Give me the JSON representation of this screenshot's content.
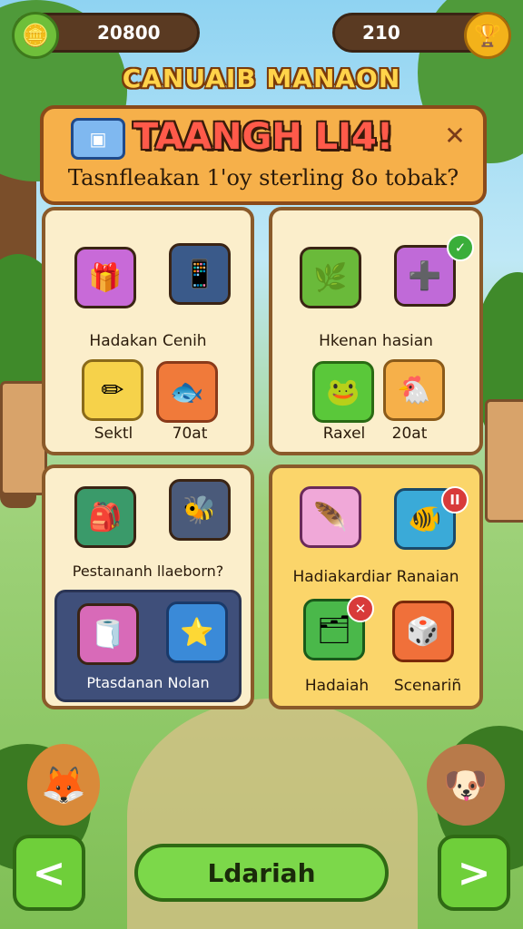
{
  "resources": {
    "coins": "20800",
    "gems": "210",
    "coin_icon": "coin-bundle-icon",
    "gem_icon": "trophy-icon"
  },
  "subtitle": "CANUAIB MANAON",
  "banner": {
    "title": "TAANGH LI4!",
    "text": "Tasnfleakan 1'oy sterling 8o tobak?"
  },
  "panels": {
    "p1": {
      "label_top": "Hadakan Cenih",
      "item_a": "Sektl",
      "item_b": "70at"
    },
    "p2": {
      "label_top": "Hkenan hasian",
      "item_a": "Raxel",
      "item_b": "20at"
    },
    "p3": {
      "label_top": "Pestaınanh llaeborn?",
      "sub_label": "Ptasdanan Nolan"
    },
    "p4": {
      "label_top": "Hadiakardiar Ranaian",
      "item_a": "Hadaiah",
      "item_b": "Scenariñ"
    }
  },
  "buttons": {
    "prev": "<",
    "next": ">",
    "main": "Ldariah"
  },
  "colors": {
    "accent_green": "#6fcf3a",
    "panel_cream": "#fbeecb",
    "panel_gold": "#fbd56a",
    "banner_orange": "#f6b04a"
  }
}
